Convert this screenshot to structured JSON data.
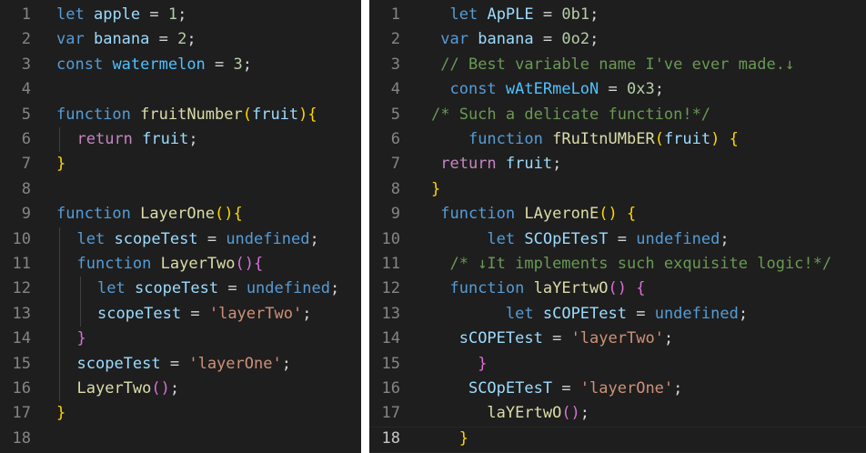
{
  "left_pane": {
    "lines": [
      {
        "n": "1",
        "indent": 0,
        "tokens": [
          [
            "let",
            "kw"
          ],
          [
            " ",
            "op"
          ],
          [
            "apple",
            "var"
          ],
          [
            " = ",
            "op"
          ],
          [
            "1",
            "num"
          ],
          [
            ";",
            "op"
          ]
        ]
      },
      {
        "n": "2",
        "indent": 0,
        "tokens": [
          [
            "var",
            "kw"
          ],
          [
            " ",
            "op"
          ],
          [
            "banana",
            "var"
          ],
          [
            " = ",
            "op"
          ],
          [
            "2",
            "num"
          ],
          [
            ";",
            "op"
          ]
        ]
      },
      {
        "n": "3",
        "indent": 0,
        "tokens": [
          [
            "const",
            "kw"
          ],
          [
            " ",
            "op"
          ],
          [
            "watermelon",
            "cst"
          ],
          [
            " = ",
            "op"
          ],
          [
            "3",
            "num"
          ],
          [
            ";",
            "op"
          ]
        ]
      },
      {
        "n": "4",
        "indent": 0,
        "tokens": []
      },
      {
        "n": "5",
        "indent": 0,
        "tokens": [
          [
            "function",
            "kw"
          ],
          [
            " ",
            "op"
          ],
          [
            "fruitNumber",
            "fn"
          ],
          [
            "(",
            "br1"
          ],
          [
            "fruit",
            "var"
          ],
          [
            ")",
            "br1"
          ],
          [
            "{",
            "br1"
          ]
        ]
      },
      {
        "n": "6",
        "indent": 1,
        "tokens": [
          [
            "return",
            "cf"
          ],
          [
            " ",
            "op"
          ],
          [
            "fruit",
            "var"
          ],
          [
            ";",
            "op"
          ]
        ]
      },
      {
        "n": "7",
        "indent": 0,
        "tokens": [
          [
            "}",
            "br1"
          ]
        ]
      },
      {
        "n": "8",
        "indent": 0,
        "tokens": []
      },
      {
        "n": "9",
        "indent": 0,
        "tokens": [
          [
            "function",
            "kw"
          ],
          [
            " ",
            "op"
          ],
          [
            "LayerOne",
            "fn"
          ],
          [
            "()",
            "br1"
          ],
          [
            "{",
            "br1"
          ]
        ]
      },
      {
        "n": "10",
        "indent": 1,
        "tokens": [
          [
            "let",
            "kw"
          ],
          [
            " ",
            "op"
          ],
          [
            "scopeTest",
            "var"
          ],
          [
            " = ",
            "op"
          ],
          [
            "undefined",
            "kw"
          ],
          [
            ";",
            "op"
          ]
        ]
      },
      {
        "n": "11",
        "indent": 1,
        "tokens": [
          [
            "function",
            "kw"
          ],
          [
            " ",
            "op"
          ],
          [
            "LayerTwo",
            "fn"
          ],
          [
            "()",
            "br2"
          ],
          [
            "{",
            "br2"
          ]
        ]
      },
      {
        "n": "12",
        "indent": 2,
        "tokens": [
          [
            "let",
            "kw"
          ],
          [
            " ",
            "op"
          ],
          [
            "scopeTest",
            "var"
          ],
          [
            " = ",
            "op"
          ],
          [
            "undefined",
            "kw"
          ],
          [
            ";",
            "op"
          ]
        ]
      },
      {
        "n": "13",
        "indent": 2,
        "tokens": [
          [
            "scopeTest",
            "var"
          ],
          [
            " = ",
            "op"
          ],
          [
            "'layerTwo'",
            "str"
          ],
          [
            ";",
            "op"
          ]
        ]
      },
      {
        "n": "14",
        "indent": 1,
        "tokens": [
          [
            "}",
            "br2"
          ]
        ]
      },
      {
        "n": "15",
        "indent": 1,
        "tokens": [
          [
            "scopeTest",
            "var"
          ],
          [
            " = ",
            "op"
          ],
          [
            "'layerOne'",
            "str"
          ],
          [
            ";",
            "op"
          ]
        ]
      },
      {
        "n": "16",
        "indent": 1,
        "tokens": [
          [
            "LayerTwo",
            "fn"
          ],
          [
            "()",
            "br2"
          ],
          [
            ";",
            "op"
          ]
        ]
      },
      {
        "n": "17",
        "indent": 0,
        "tokens": [
          [
            "}",
            "br1"
          ]
        ]
      },
      {
        "n": "18",
        "indent": 0,
        "tokens": []
      }
    ]
  },
  "right_pane": {
    "active_line": "18",
    "lines": [
      {
        "n": "1",
        "indent": 0,
        "tokens": [
          [
            "  ",
            "op"
          ],
          [
            "let",
            "kw"
          ],
          [
            " ",
            "op"
          ],
          [
            "ApPLE",
            "var"
          ],
          [
            " = ",
            "op"
          ],
          [
            "0b1",
            "num"
          ],
          [
            ";",
            "op"
          ]
        ]
      },
      {
        "n": "2",
        "indent": 0,
        "tokens": [
          [
            " ",
            "op"
          ],
          [
            "var",
            "kw"
          ],
          [
            " ",
            "op"
          ],
          [
            "banana",
            "var"
          ],
          [
            " = ",
            "op"
          ],
          [
            "0o2",
            "num"
          ],
          [
            ";",
            "op"
          ]
        ]
      },
      {
        "n": "3",
        "indent": 0,
        "tokens": [
          [
            " ",
            "op"
          ],
          [
            "// Best variable name I've ever made.↓",
            "cm"
          ]
        ]
      },
      {
        "n": "4",
        "indent": 0,
        "tokens": [
          [
            "  ",
            "op"
          ],
          [
            "const",
            "kw"
          ],
          [
            " ",
            "op"
          ],
          [
            "wAtERmeLoN",
            "cst"
          ],
          [
            " = ",
            "op"
          ],
          [
            "0x3",
            "num"
          ],
          [
            ";",
            "op"
          ]
        ]
      },
      {
        "n": "5",
        "indent": 0,
        "tokens": [
          [
            "/* Such a delicate function!*/",
            "cm"
          ]
        ]
      },
      {
        "n": "6",
        "indent": 0,
        "tokens": [
          [
            "    ",
            "op"
          ],
          [
            "function",
            "kw"
          ],
          [
            " ",
            "op"
          ],
          [
            "fRuItnUMbER",
            "fn"
          ],
          [
            "(",
            "br1"
          ],
          [
            "fruit",
            "var"
          ],
          [
            ")",
            "br1"
          ],
          [
            " ",
            "op"
          ],
          [
            "{",
            "br1"
          ]
        ]
      },
      {
        "n": "7",
        "indent": 0,
        "tokens": [
          [
            " ",
            "op"
          ],
          [
            "return",
            "cf"
          ],
          [
            " ",
            "op"
          ],
          [
            "fruit",
            "var"
          ],
          [
            ";",
            "op"
          ]
        ]
      },
      {
        "n": "8",
        "indent": 0,
        "tokens": [
          [
            "}",
            "br1"
          ]
        ]
      },
      {
        "n": "9",
        "indent": 0,
        "tokens": [
          [
            " ",
            "op"
          ],
          [
            "function",
            "kw"
          ],
          [
            " ",
            "op"
          ],
          [
            "LAyeronE",
            "fn"
          ],
          [
            "()",
            "br1"
          ],
          [
            " ",
            "op"
          ],
          [
            "{",
            "br1"
          ]
        ]
      },
      {
        "n": "10",
        "indent": 0,
        "tokens": [
          [
            "      ",
            "op"
          ],
          [
            "let",
            "kw"
          ],
          [
            " ",
            "op"
          ],
          [
            "SCOpETesT",
            "var"
          ],
          [
            " = ",
            "op"
          ],
          [
            "undefined",
            "kw"
          ],
          [
            ";",
            "op"
          ]
        ]
      },
      {
        "n": "11",
        "indent": 0,
        "tokens": [
          [
            "  ",
            "op"
          ],
          [
            "/* ↓It implements such exquisite logic!*/",
            "cm"
          ]
        ]
      },
      {
        "n": "12",
        "indent": 0,
        "tokens": [
          [
            "  ",
            "op"
          ],
          [
            "function",
            "kw"
          ],
          [
            " ",
            "op"
          ],
          [
            "laYErtwO",
            "fn"
          ],
          [
            "()",
            "br2"
          ],
          [
            " ",
            "op"
          ],
          [
            "{",
            "br2"
          ]
        ]
      },
      {
        "n": "13",
        "indent": 0,
        "tokens": [
          [
            "        ",
            "op"
          ],
          [
            "let",
            "kw"
          ],
          [
            " ",
            "op"
          ],
          [
            "sCOPETest",
            "var"
          ],
          [
            " = ",
            "op"
          ],
          [
            "undefined",
            "kw"
          ],
          [
            ";",
            "op"
          ]
        ]
      },
      {
        "n": "14",
        "indent": 0,
        "tokens": [
          [
            "   ",
            "op"
          ],
          [
            "sCOPETest",
            "var"
          ],
          [
            " = ",
            "op"
          ],
          [
            "'layerTwo'",
            "str"
          ],
          [
            ";",
            "op"
          ]
        ]
      },
      {
        "n": "15",
        "indent": 0,
        "tokens": [
          [
            "     ",
            "op"
          ],
          [
            "}",
            "br2"
          ]
        ]
      },
      {
        "n": "16",
        "indent": 0,
        "tokens": [
          [
            "    ",
            "op"
          ],
          [
            "SCOpETesT",
            "var"
          ],
          [
            " = ",
            "op"
          ],
          [
            "'layerOne'",
            "str"
          ],
          [
            ";",
            "op"
          ]
        ]
      },
      {
        "n": "17",
        "indent": 0,
        "tokens": [
          [
            "      ",
            "op"
          ],
          [
            "laYErtwO",
            "fn"
          ],
          [
            "()",
            "br2"
          ],
          [
            ";",
            "op"
          ]
        ]
      },
      {
        "n": "18",
        "indent": 0,
        "tokens": [
          [
            "   ",
            "op"
          ],
          [
            "}",
            "br1"
          ]
        ]
      }
    ]
  }
}
